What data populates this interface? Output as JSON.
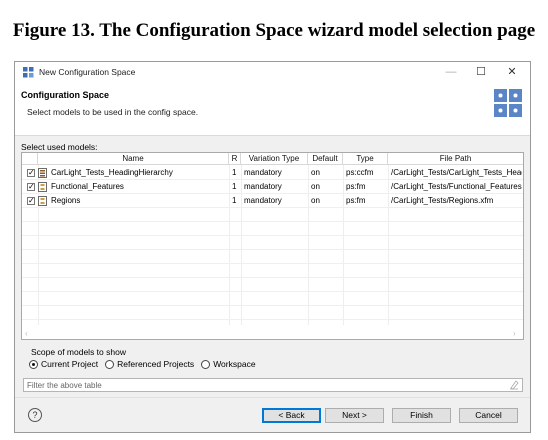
{
  "caption": "Figure 13. The Configuration Space wizard model selection page",
  "window": {
    "title": "New Configuration Space",
    "minimize_glyph": "—",
    "maximize_glyph": "☐",
    "close_glyph": "✕"
  },
  "header": {
    "title": "Configuration Space",
    "description": "Select models to be used in the config space."
  },
  "models_label": "Select used models:",
  "table": {
    "columns": [
      "Name",
      "R",
      "Variation Type",
      "Default",
      "Type",
      "File Path"
    ],
    "rows": [
      {
        "checked": true,
        "icon": "hierarchy-model-icon",
        "name": "CarLight_Tests_HeadingHierarchy",
        "r": "1",
        "variation_type": "mandatory",
        "default": "on",
        "type": "ps:ccfm",
        "file_path": "/CarLight_Tests/CarLight_Tests_Headi..."
      },
      {
        "checked": true,
        "icon": "feature-model-icon",
        "name": "Functional_Features",
        "r": "1",
        "variation_type": "mandatory",
        "default": "on",
        "type": "ps:fm",
        "file_path": "/CarLight_Tests/Functional_Features...."
      },
      {
        "checked": true,
        "icon": "feature-model-icon",
        "name": "Regions",
        "r": "1",
        "variation_type": "mandatory",
        "default": "on",
        "type": "ps:fm",
        "file_path": "/CarLight_Tests/Regions.xfm"
      }
    ]
  },
  "scope": {
    "label": "Scope of models to show",
    "options": [
      "Current Project",
      "Referenced Projects",
      "Workspace"
    ],
    "selected": "Current Project"
  },
  "filter": {
    "placeholder": "Filter the above table",
    "value": ""
  },
  "buttons": {
    "help": "?",
    "back": "< Back",
    "next": "Next >",
    "finish": "Finish",
    "cancel": "Cancel"
  },
  "colors": {
    "wizard_icon": "#5a86c7",
    "default_button_border": "#0078d7"
  }
}
